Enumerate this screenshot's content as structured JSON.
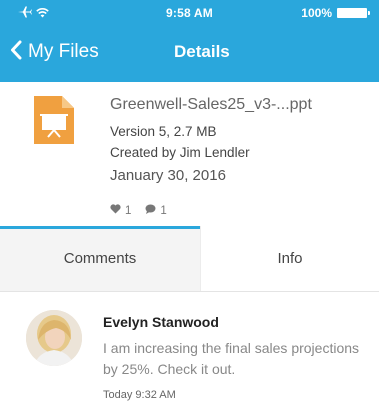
{
  "status_bar": {
    "time": "9:58 AM",
    "battery_percent": "100%",
    "icons": [
      "airplane-icon",
      "wifi-icon",
      "battery-icon"
    ]
  },
  "nav": {
    "back_label": "My Files",
    "title": "Details"
  },
  "file": {
    "name": "Greenwell-Sales25_v3-...ppt",
    "version": "Version 5, 2.7 MB",
    "created_by": "Created by Jim Lendler",
    "date": "January 30, 2016",
    "likes": "1",
    "comments": "1",
    "icon": "presentation-file-icon"
  },
  "tabs": {
    "comments": "Comments",
    "info": "Info",
    "active": "comments"
  },
  "comment": {
    "author": "Evelyn Stanwood",
    "text": "I am increasing the final sales projections by 25%. Check it out.",
    "time": "Today 9:32 AM"
  },
  "colors": {
    "accent": "#2aa7dc",
    "file_icon": "#f0a040"
  }
}
